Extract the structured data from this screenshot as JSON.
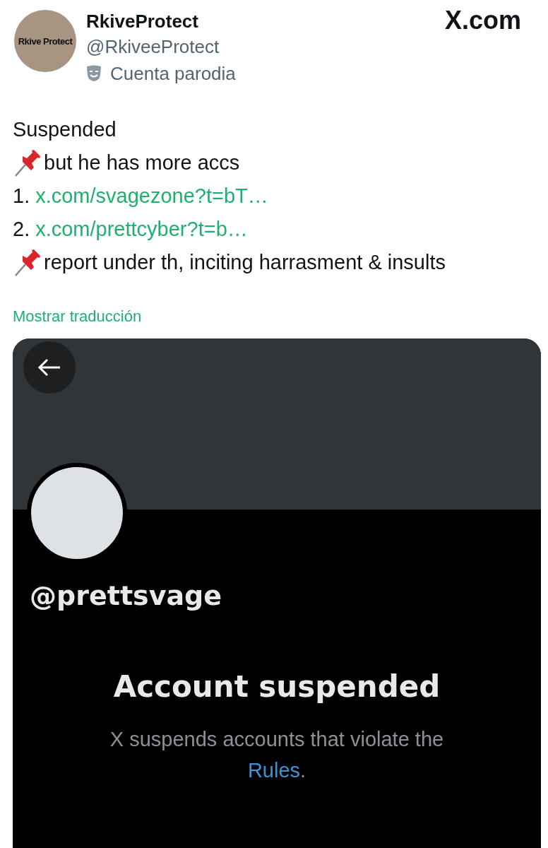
{
  "author": {
    "avatar_label": "Rkive Protect",
    "name": "RkiveProtect",
    "handle": "@RkiveeProtect",
    "badge": "Cuenta parodia"
  },
  "brand": "X.com",
  "tweet_lines": [
    {
      "kind": "text",
      "text": "Suspended"
    },
    {
      "kind": "pin",
      "text": "but he has more accs"
    },
    {
      "kind": "link",
      "number": "1.",
      "url": "x.com/svagezone?t=bT…"
    },
    {
      "kind": "link",
      "number": "2.",
      "url": "x.com/prettcyber?t=b…"
    },
    {
      "kind": "pin",
      "text": "report under th, inciting harrasment & insults"
    }
  ],
  "translate_link": "Mostrar traducción",
  "embedded_screen": {
    "handle": "@prettsvage",
    "title": "Account suspended",
    "message": "X suspends accounts that violate the",
    "rules_link": "Rules",
    "message_end": "."
  }
}
